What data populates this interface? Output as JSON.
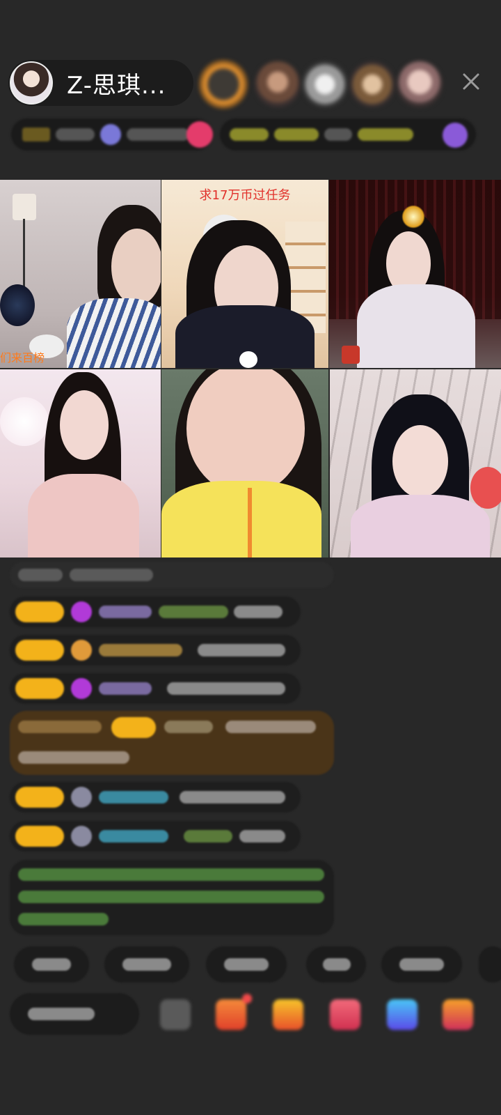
{
  "header": {
    "host_name": "Z-思琪...",
    "close_icon": "close-icon"
  },
  "grid": {
    "tiles": [
      {
        "caption": "",
        "overlay": "们来百榜"
      },
      {
        "caption": "求17万币过任务",
        "overlay": ""
      },
      {
        "caption": "",
        "overlay": ""
      },
      {
        "caption": "",
        "overlay": ""
      },
      {
        "caption": "",
        "overlay": ""
      },
      {
        "caption": "",
        "overlay": ""
      }
    ]
  },
  "colors": {
    "background": "#282828",
    "badge_gold": "#f3b21a",
    "caption_red": "#e1302a",
    "chat_highlight": "#4a3418"
  }
}
